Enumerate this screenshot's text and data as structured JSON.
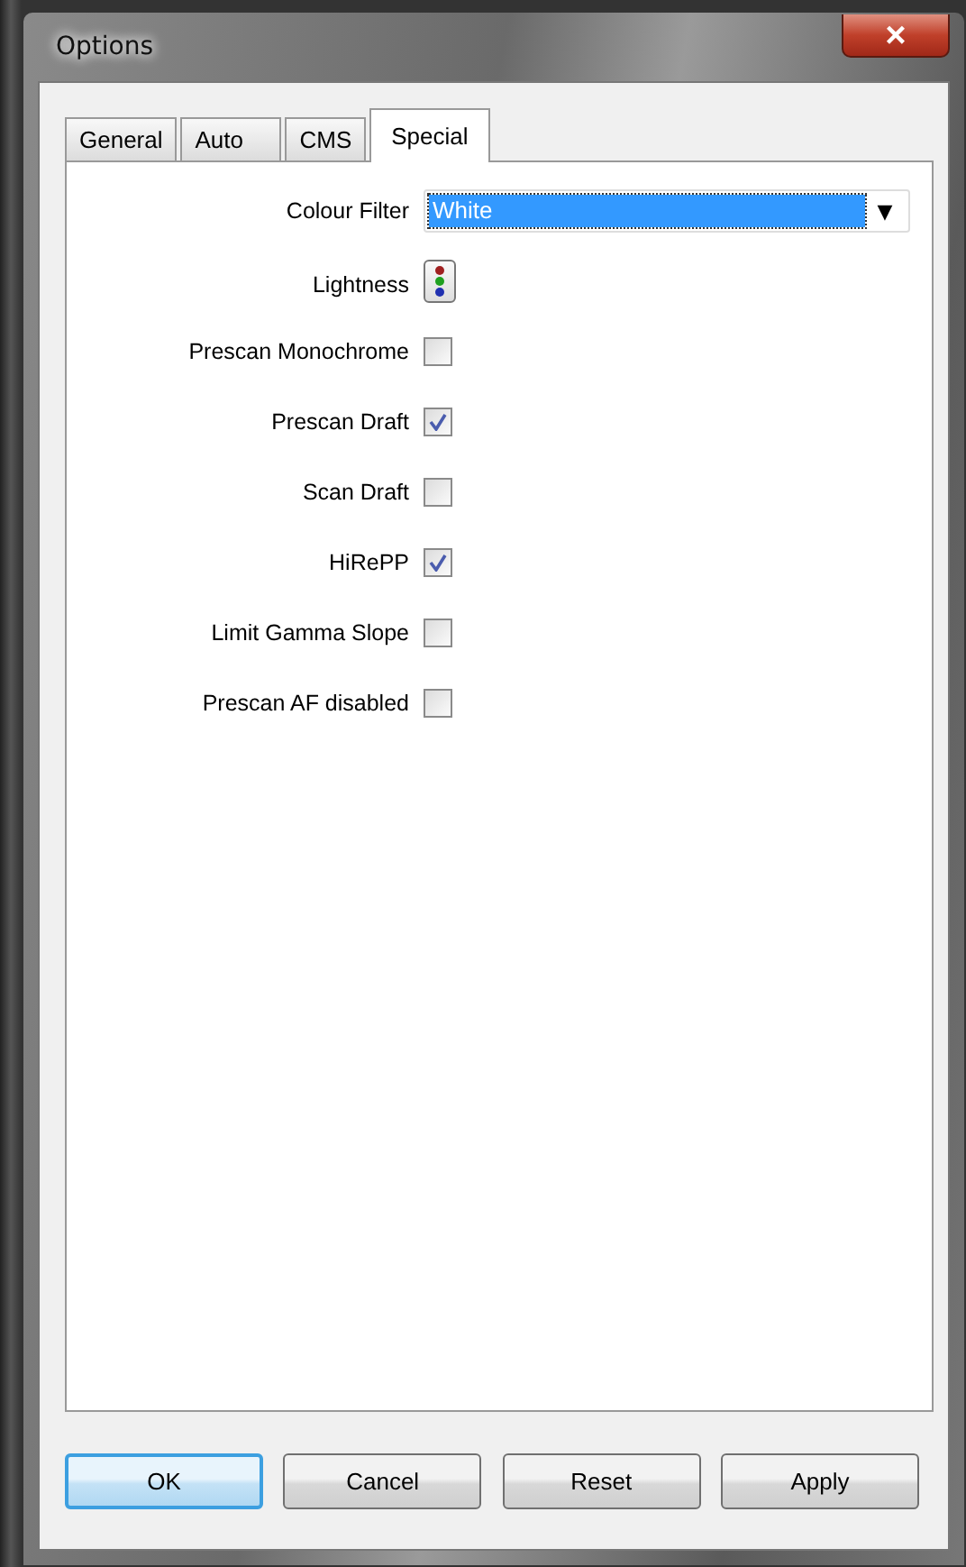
{
  "window": {
    "title": "Options",
    "close": "×"
  },
  "tabs": [
    {
      "label": "General",
      "selected": false
    },
    {
      "label": "Auto",
      "selected": false
    },
    {
      "label": "CMS",
      "selected": false
    },
    {
      "label": "Special",
      "selected": true
    }
  ],
  "options": [
    {
      "kind": "dropdown",
      "label": "Colour Filter",
      "value": "White",
      "arrow": "▼"
    },
    {
      "kind": "button",
      "label": "Lightness"
    },
    {
      "kind": "checkbox",
      "label": "Prescan Monochrome",
      "checked": false
    },
    {
      "kind": "checkbox",
      "label": "Prescan Draft",
      "checked": true
    },
    {
      "kind": "checkbox",
      "label": "Scan Draft",
      "checked": false
    },
    {
      "kind": "checkbox",
      "label": "HiRePP",
      "checked": true
    },
    {
      "kind": "checkbox",
      "label": "Limit Gamma Slope",
      "checked": false
    },
    {
      "kind": "checkbox",
      "label": "Prescan AF disabled",
      "checked": false
    }
  ],
  "buttons": [
    {
      "label": "OK",
      "default": true
    },
    {
      "label": "Cancel",
      "default": false
    },
    {
      "label": "Reset",
      "default": false
    },
    {
      "label": "Apply",
      "default": false
    }
  ]
}
